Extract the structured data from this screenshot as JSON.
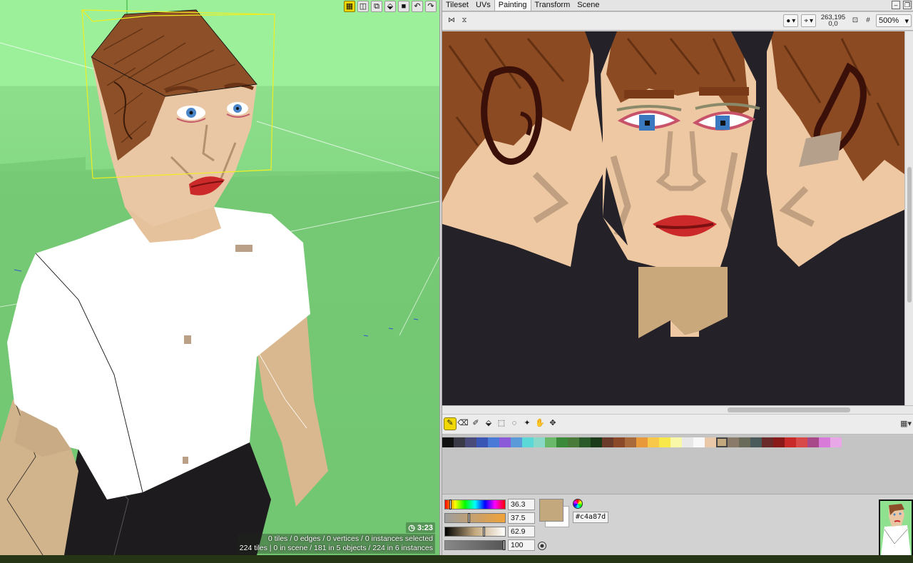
{
  "viewport": {
    "toolbar_icons": [
      "grid-icon",
      "cube-icon",
      "layers-icon",
      "paint-bucket-icon",
      "square-icon",
      "undo-icon",
      "redo-icon"
    ],
    "timer": "3:23",
    "status_line1": "0 tiles / 0 edges / 0 vertices / 0 instances selected",
    "status_line2": "224 tiles | 0 in scene / 181 in 5 objects / 224 in 6 instances"
  },
  "tabs": [
    {
      "label": "Tileset"
    },
    {
      "label": "UVs"
    },
    {
      "label": "Painting"
    },
    {
      "label": "Transform"
    },
    {
      "label": "Scene"
    }
  ],
  "paint_toolbar": {
    "brush_symbol": "●",
    "cursor_x_y": "263,195",
    "cursor_offset": "0,0",
    "zoom": "500%"
  },
  "palette": [
    "#111111",
    "#3a3a46",
    "#4b4b7a",
    "#3a56b4",
    "#4a7ad8",
    "#8a5ad8",
    "#5a9ad8",
    "#5ad8d8",
    "#8ad8c8",
    "#6ab86a",
    "#3a8a3a",
    "#4a7a3a",
    "#2a5a2a",
    "#1a3a1a",
    "#6a3a2a",
    "#8a4a2a",
    "#a86a3a",
    "#e89a3a",
    "#f8c84a",
    "#f8e84a",
    "#f8f8a8",
    "#e8e8e8",
    "#f8f8f8",
    "#e8c8a8",
    "#c4a87d",
    "#8a7a6a",
    "#6a6a5a",
    "#4a5a5a",
    "#6a2a2a",
    "#8a1a1a",
    "#c82a2a",
    "#d84a4a",
    "#a84a8a",
    "#d87ad8",
    "#e8a8e8"
  ],
  "selected_swatch": 24,
  "color_editor": {
    "hue": "36.3",
    "saturation": "37.5",
    "value": "62.9",
    "alpha": "100",
    "hex": "#c4a87d",
    "current_color": "#c4a87d"
  }
}
